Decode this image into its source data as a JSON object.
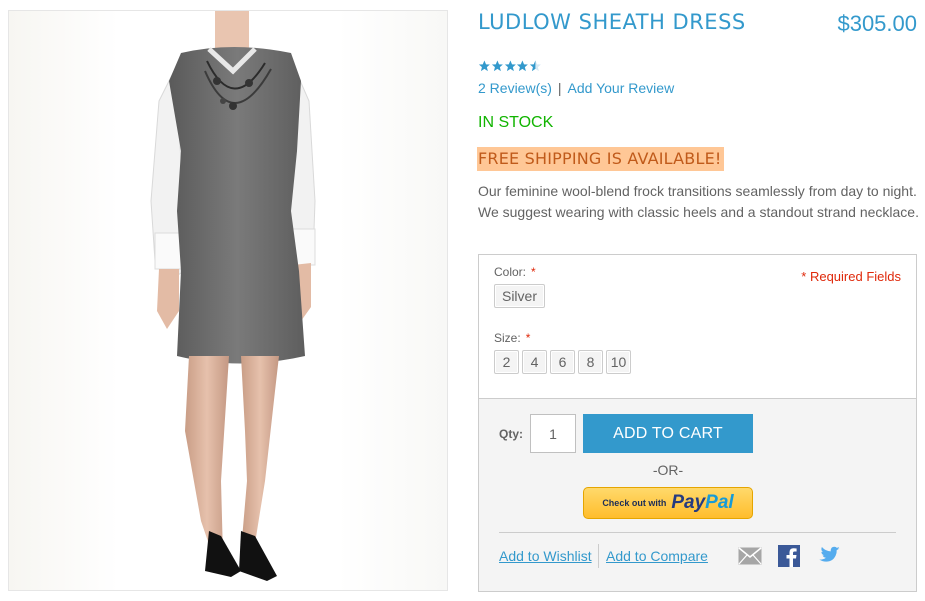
{
  "product": {
    "name": "LUDLOW SHEATH DRESS",
    "price": "$305.00",
    "rating_fraction": 0.9,
    "review_count_label": "2 Review(s)",
    "review_separator": "|",
    "add_review_label": "Add Your Review",
    "stock_status": "IN STOCK",
    "shipping_notice": "FREE SHIPPING IS AVAILABLE!",
    "description": "Our feminine wool-blend frock transitions seamlessly from day to night. We suggest wearing with classic heels and a standout strand necklace."
  },
  "options": {
    "required_note": "* Required Fields",
    "color_label": "Color:",
    "color_required": "*",
    "color_values": [
      "Silver"
    ],
    "size_label": "Size:",
    "size_required": "*",
    "size_values": [
      "2",
      "4",
      "6",
      "8",
      "10"
    ]
  },
  "cart": {
    "qty_label": "Qty:",
    "qty_value": "1",
    "add_to_cart_label": "ADD TO CART",
    "or_label": "-OR-",
    "paypal_small": "Check out with",
    "paypal_pay": "Pay",
    "paypal_pal": "Pal",
    "wishlist_label": "Add to Wishlist",
    "compare_label": "Add to Compare"
  },
  "colors": {
    "accent": "#3399cc",
    "in_stock": "#11b400",
    "shipping_bg": "#ffc796",
    "required": "#df280a"
  },
  "icons": {
    "rating": "star-icon",
    "email": "email-icon",
    "facebook": "facebook-icon",
    "twitter": "twitter-icon"
  }
}
